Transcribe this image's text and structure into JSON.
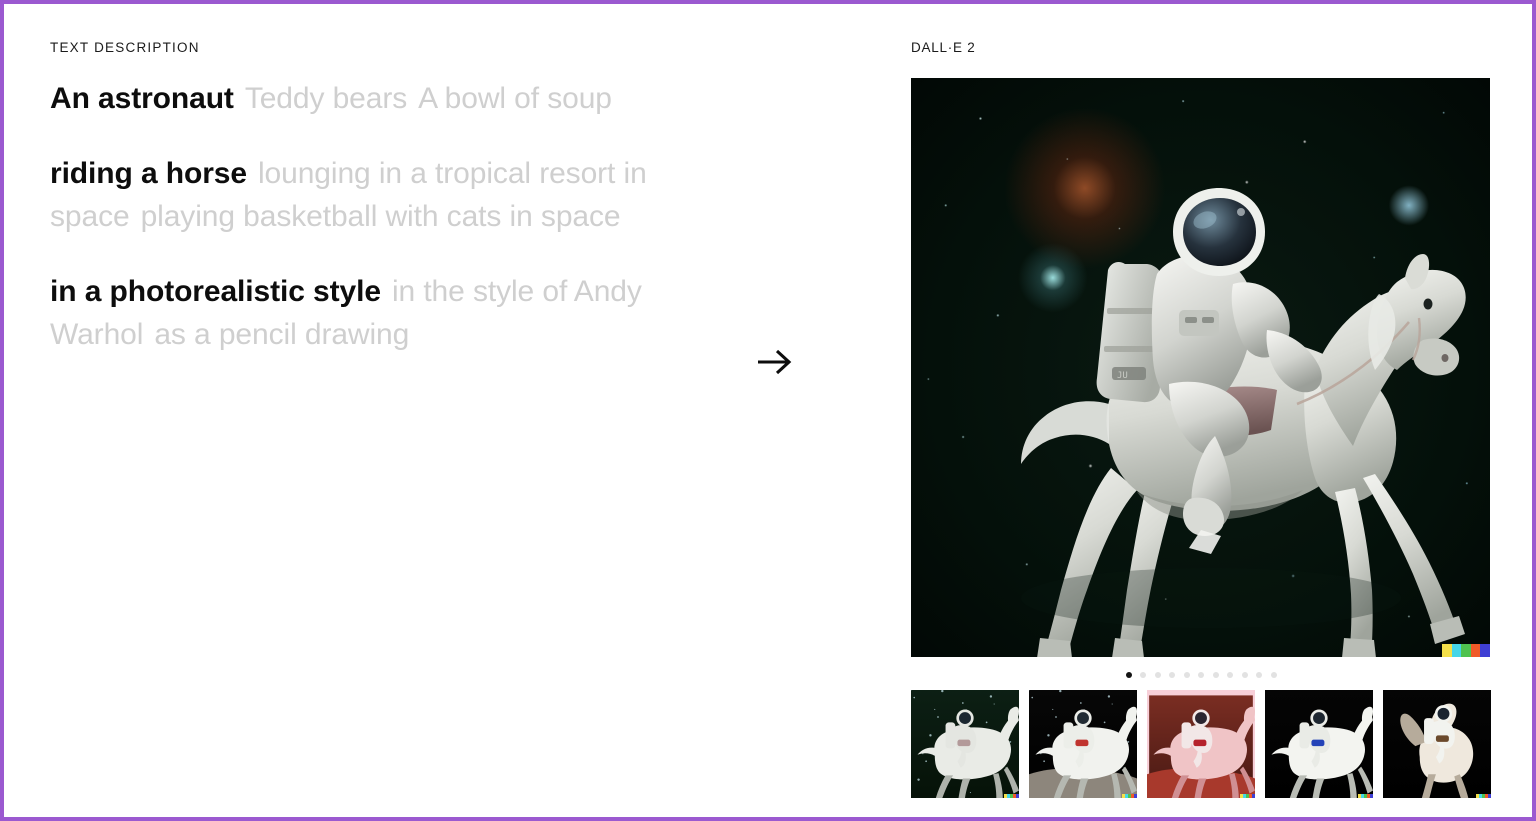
{
  "page": {
    "border_color": "#9b59d0",
    "background": "#ffffff"
  },
  "left": {
    "section_label": "TEXT DESCRIPTION",
    "active_color": "#0d0d0d",
    "muted_color": "#cfcfcf",
    "groups": [
      {
        "id": "subject",
        "options": [
          {
            "text": "An astronaut",
            "state": "selected"
          },
          {
            "text": "Teddy bears",
            "state": "muted"
          },
          {
            "text": "A bowl of soup",
            "state": "muted"
          }
        ]
      },
      {
        "id": "action",
        "options": [
          {
            "text": "riding a horse",
            "state": "selected"
          },
          {
            "text": "lounging in a tropical resort in space",
            "state": "muted"
          },
          {
            "text": "playing basketball with cats in space",
            "state": "muted"
          }
        ]
      },
      {
        "id": "style",
        "options": [
          {
            "text": "in a photorealistic style",
            "state": "selected"
          },
          {
            "text": "in the style of Andy Warhol",
            "state": "muted"
          },
          {
            "text": "as a pencil drawing",
            "state": "muted"
          }
        ]
      }
    ]
  },
  "arrow": {
    "icon": "arrow-right-icon"
  },
  "right": {
    "model_label": "DALL·E 2",
    "hero": {
      "alt": "Photorealistic astronaut riding a white horse in outer space",
      "watermark_colors": [
        "#f4e04a",
        "#45d6e8",
        "#4fc24f",
        "#f05a28",
        "#3f3fd4"
      ]
    },
    "pagination": {
      "total": 11,
      "active_index": 0
    },
    "thumbnails": [
      {
        "alt": "Astronaut riding white horse in green starfield",
        "selected": false
      },
      {
        "alt": "Astronaut riding white horse on lunar surface",
        "selected": false
      },
      {
        "alt": "Astronaut riding pink horse on Mars with pink border",
        "selected": false
      },
      {
        "alt": "Astronaut in blue suit riding white horse on black background",
        "selected": false
      },
      {
        "alt": "Astronaut riding rearing white horse on black background",
        "selected": false
      }
    ]
  }
}
